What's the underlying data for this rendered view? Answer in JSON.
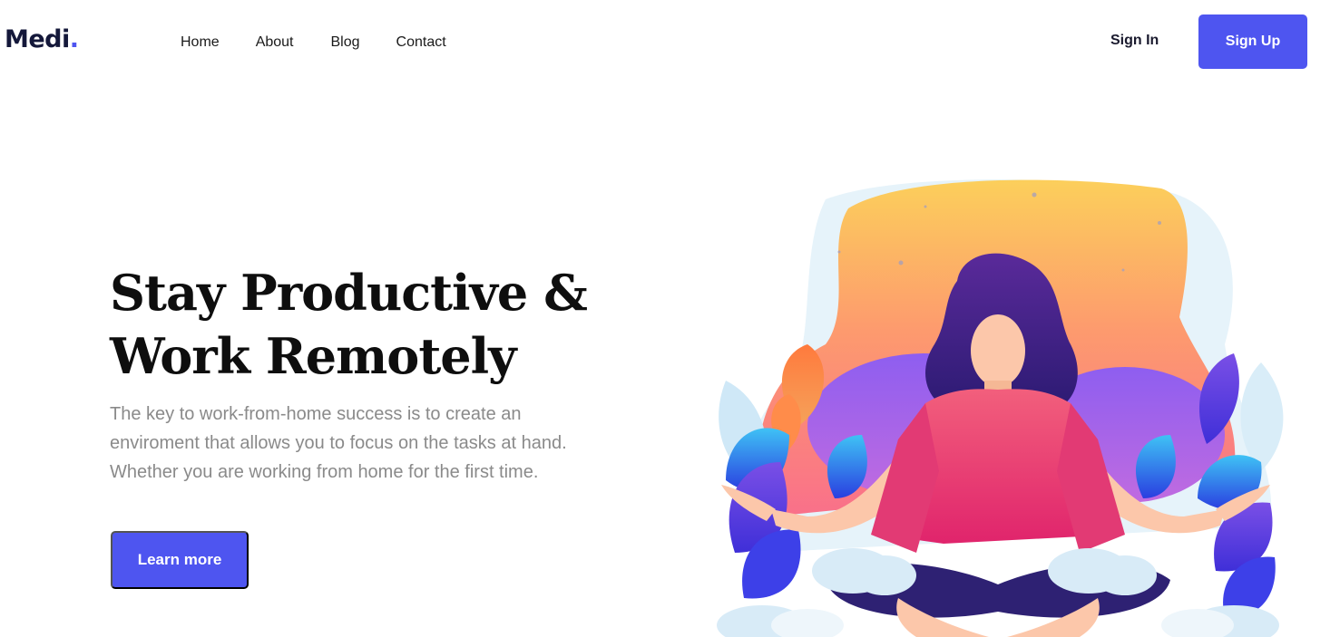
{
  "brand": {
    "name": "Medi",
    "dot": ".",
    "accent": "#4e55f0"
  },
  "nav": {
    "items": [
      "Home",
      "About",
      "Blog",
      "Contact"
    ]
  },
  "auth": {
    "signin_label": "Sign In",
    "signup_label": "Sign Up"
  },
  "hero": {
    "title_lines": [
      "Stay Productive &",
      "Work Remotely"
    ],
    "text_lines": [
      "The key to work-from-home success is to create an",
      "enviroment that allows you to focus on the tasks at hand.",
      "Whether you are working from home for the first time."
    ],
    "cta_label": "Learn more"
  },
  "illustration": {
    "icon": "meditating-woman-illustration"
  }
}
